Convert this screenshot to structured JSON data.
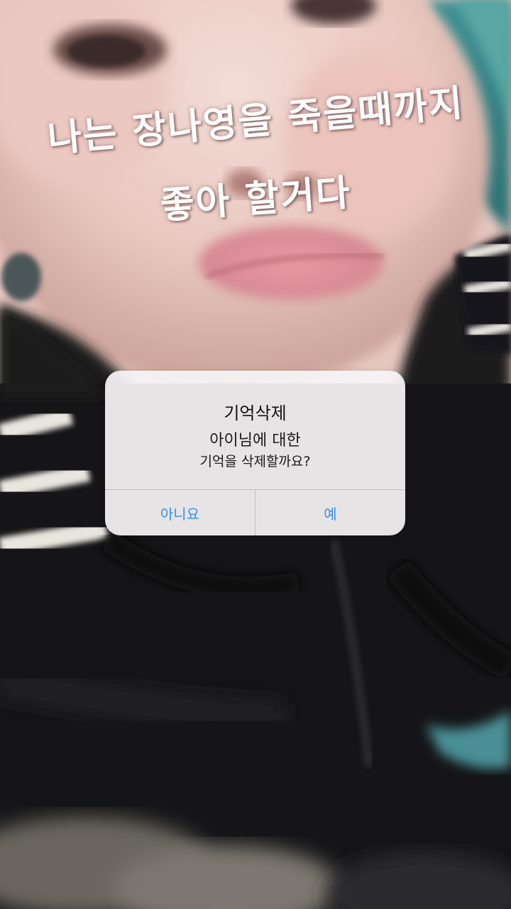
{
  "caption": {
    "line1": "나는 장나영을 죽을때까지",
    "line2": "좋아 할거다"
  },
  "alert": {
    "title": "기억삭제",
    "message_line1": "아이님에 대한",
    "message_line2": "기억을 삭제할까요?",
    "cancel_label": "아니요",
    "confirm_label": "예"
  },
  "colors": {
    "button_text": "#3a8ee6",
    "dialog_background": "#f6f4f5",
    "caption_text": "#ffffff"
  }
}
